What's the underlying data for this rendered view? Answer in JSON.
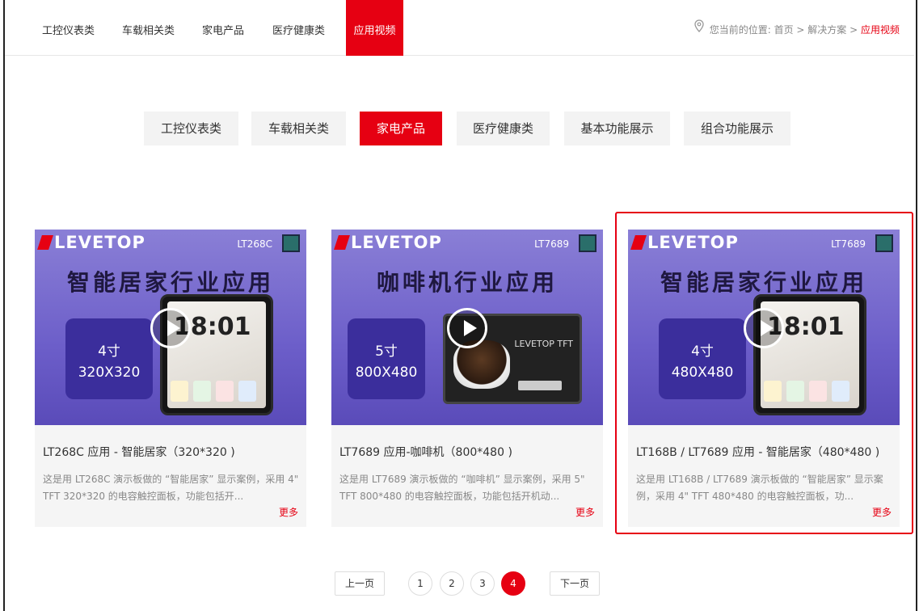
{
  "topnav": {
    "items": [
      "工控仪表类",
      "车载相关类",
      "家电产品",
      "医疗健康类",
      "应用视频"
    ],
    "active_index": 4
  },
  "breadcrumb": {
    "prefix": "您当前的位置:",
    "home": "首页",
    "sep1": " > ",
    "section": "解决方案",
    "sep2": " > ",
    "current": "应用视频"
  },
  "tabs": {
    "items": [
      "工控仪表类",
      "车载相关类",
      "家电产品",
      "医疗健康类",
      "基本功能展示",
      "组合功能展示"
    ],
    "active_index": 2
  },
  "cards": [
    {
      "logo": "LEVETOP",
      "model": "LT268C",
      "headline": "智能居家行业应用",
      "size_line1": "4寸",
      "size_line2": "320X320",
      "clock": "18:01",
      "title": "LT268C 应用 - 智能居家（320*320 )",
      "desc": "这是用 LT268C 演示板做的 “智能居家” 显示案例，采用 4\" TFT 320*320 的电容触控面板，功能包括开...",
      "more": "更多"
    },
    {
      "logo": "LEVETOP",
      "model": "LT7689",
      "headline": "咖啡机行业应用",
      "size_line1": "5寸",
      "size_line2": "800X480",
      "tft_brand": "LEVETOP TFT",
      "title": "LT7689 应用-咖啡机（800*480 )",
      "desc": "这是用 LT7689 演示板做的 “咖啡机” 显示案例，采用 5\" TFT 800*480 的电容触控面板，功能包括开机动...",
      "more": "更多"
    },
    {
      "logo": "LEVETOP",
      "model": "LT7689",
      "headline": "智能居家行业应用",
      "size_line1": "4寸",
      "size_line2": "480X480",
      "clock": "18:01",
      "title": "LT168B / LT7689 应用 - 智能居家（480*480 )",
      "desc": "这是用 LT168B / LT7689 演示板做的 “智能居家” 显示案例，采用 4\" TFT 480*480 的电容触控面板，功...",
      "more": "更多"
    }
  ],
  "pagination": {
    "prev": "上一页",
    "pages": [
      "1",
      "2",
      "3",
      "4"
    ],
    "current": "4",
    "next": "下一页"
  },
  "colors": {
    "accent": "#e60012",
    "tab_bg": "#f3f3f3",
    "card_bg": "#f5f5f5"
  }
}
